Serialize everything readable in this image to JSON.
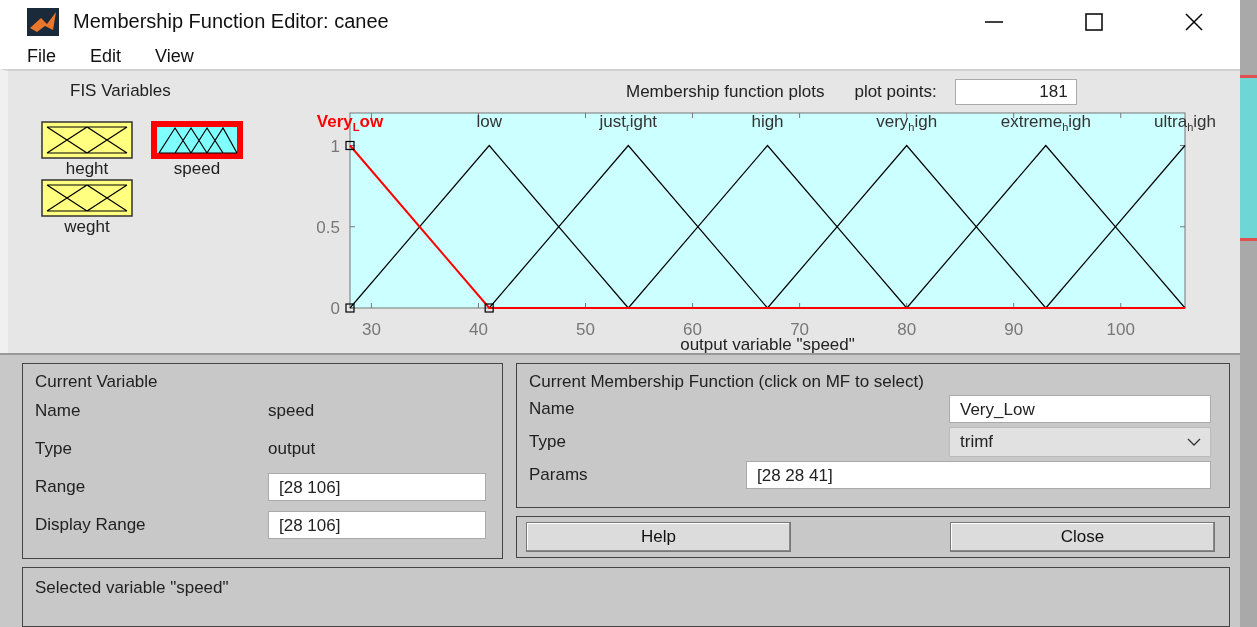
{
  "window": {
    "title": "Membership Function Editor: canee"
  },
  "menu": [
    "File",
    "Edit",
    "View"
  ],
  "fis_variables": {
    "title": "FIS Variables",
    "items": [
      {
        "name": "heght",
        "kind": "input",
        "selected": false
      },
      {
        "name": "speed",
        "kind": "output",
        "selected": true
      },
      {
        "name": "weght",
        "kind": "input",
        "selected": false
      }
    ]
  },
  "plot": {
    "title": "Membership function plots",
    "plot_points_label": "plot points:",
    "plot_points": "181",
    "chart_data": {
      "type": "line",
      "xlabel": "output variable \"speed\"",
      "x": [
        28,
        41,
        54,
        67,
        80,
        93,
        106
      ],
      "xlim": [
        28,
        106
      ],
      "ylim": [
        0,
        1.2
      ],
      "xticks": [
        30,
        40,
        50,
        60,
        70,
        80,
        90,
        100
      ],
      "yticks": [
        0,
        0.5,
        1
      ],
      "series": [
        {
          "name": "Very$_{L}$ow",
          "color": "#ff0000",
          "values": [
            1,
            0,
            0,
            0,
            0,
            0,
            0
          ]
        },
        {
          "name": "low",
          "color": "#000000",
          "values": [
            0,
            1,
            0,
            null,
            null,
            null,
            null
          ]
        },
        {
          "name": "just$_{r}$ight",
          "color": "#000000",
          "values": [
            null,
            0,
            1,
            0,
            null,
            null,
            null
          ]
        },
        {
          "name": "high",
          "color": "#000000",
          "values": [
            null,
            null,
            0,
            1,
            0,
            null,
            null
          ]
        },
        {
          "name": "very$_{h}$igh",
          "color": "#000000",
          "values": [
            null,
            null,
            null,
            0,
            1,
            0,
            null
          ]
        },
        {
          "name": "extreme$_{h}$igh",
          "color": "#000000",
          "values": [
            null,
            null,
            null,
            null,
            0,
            1,
            0
          ]
        },
        {
          "name": "ultra$_{h}$igh",
          "color": "#000000",
          "values": [
            null,
            null,
            null,
            null,
            null,
            0,
            1
          ]
        }
      ]
    }
  },
  "current_variable": {
    "title": "Current Variable",
    "rows": [
      {
        "label": "Name",
        "kind": "text",
        "value": "speed"
      },
      {
        "label": "Type",
        "kind": "text",
        "value": "output"
      },
      {
        "label": "Range",
        "kind": "field",
        "value": "[28 106]"
      },
      {
        "label": "Display Range",
        "kind": "field",
        "value": "[28 106]"
      }
    ]
  },
  "current_mf": {
    "title": "Current Membership Function (click on MF to select)",
    "rows": [
      {
        "label": "Name",
        "kind": "field",
        "value": "Very_Low"
      },
      {
        "label": "Type",
        "kind": "dropdown",
        "value": "trimf"
      },
      {
        "label": "Params",
        "kind": "wide_field",
        "value": "[28 28 41]"
      }
    ]
  },
  "buttons": [
    "Help",
    "Close"
  ],
  "status": "Selected variable \"speed\""
}
